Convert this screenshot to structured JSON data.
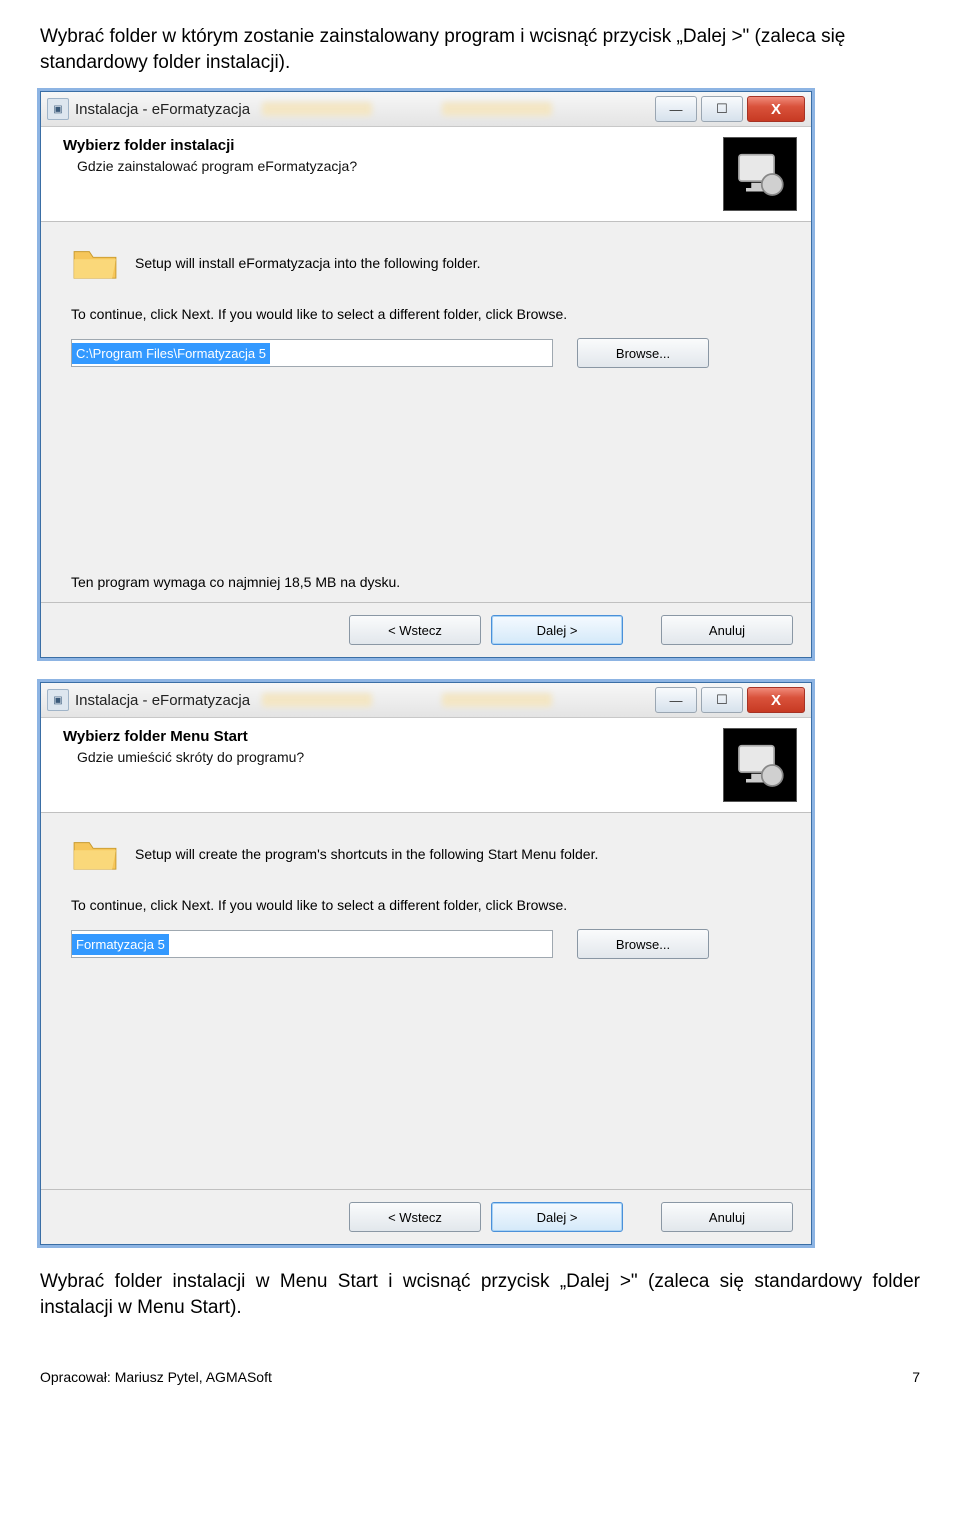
{
  "text": {
    "para1": "Wybrać folder w którym zostanie zainstalowany program i wcisnąć przycisk „Dalej >\" (zaleca się standardowy folder instalacji).",
    "para2": "Wybrać folder instalacji w Menu Start i wcisnąć przycisk „Dalej >\" (zaleca się standardowy folder instalacji w Menu Start)."
  },
  "win1": {
    "title": "Instalacja - eFormatyzacja",
    "header_title": "Wybierz folder instalacji",
    "header_sub": "Gdzie zainstalować program eFormatyzacja?",
    "msg": "Setup will install eFormatyzacja into the following folder.",
    "msg2": "To continue, click Next. If you would like to select a different folder, click Browse.",
    "path": "C:\\Program Files\\Formatyzacja 5",
    "browse": "Browse...",
    "diskreq": "Ten program wymaga co najmniej 18,5 MB na dysku.",
    "back": "< Wstecz",
    "next": "Dalej >",
    "cancel": "Anuluj"
  },
  "win2": {
    "title": "Instalacja - eFormatyzacja",
    "header_title": "Wybierz folder Menu Start",
    "header_sub": "Gdzie umieścić skróty do programu?",
    "msg": "Setup will create the program's shortcuts in the following Start Menu folder.",
    "msg2": "To continue, click Next. If you would like to select a different folder, click Browse.",
    "path": "Formatyzacja 5",
    "browse": "Browse...",
    "back": "< Wstecz",
    "next": "Dalej >",
    "cancel": "Anuluj"
  },
  "footer": {
    "author": "Opracował: Mariusz Pytel, AGMASoft",
    "page": "7"
  }
}
